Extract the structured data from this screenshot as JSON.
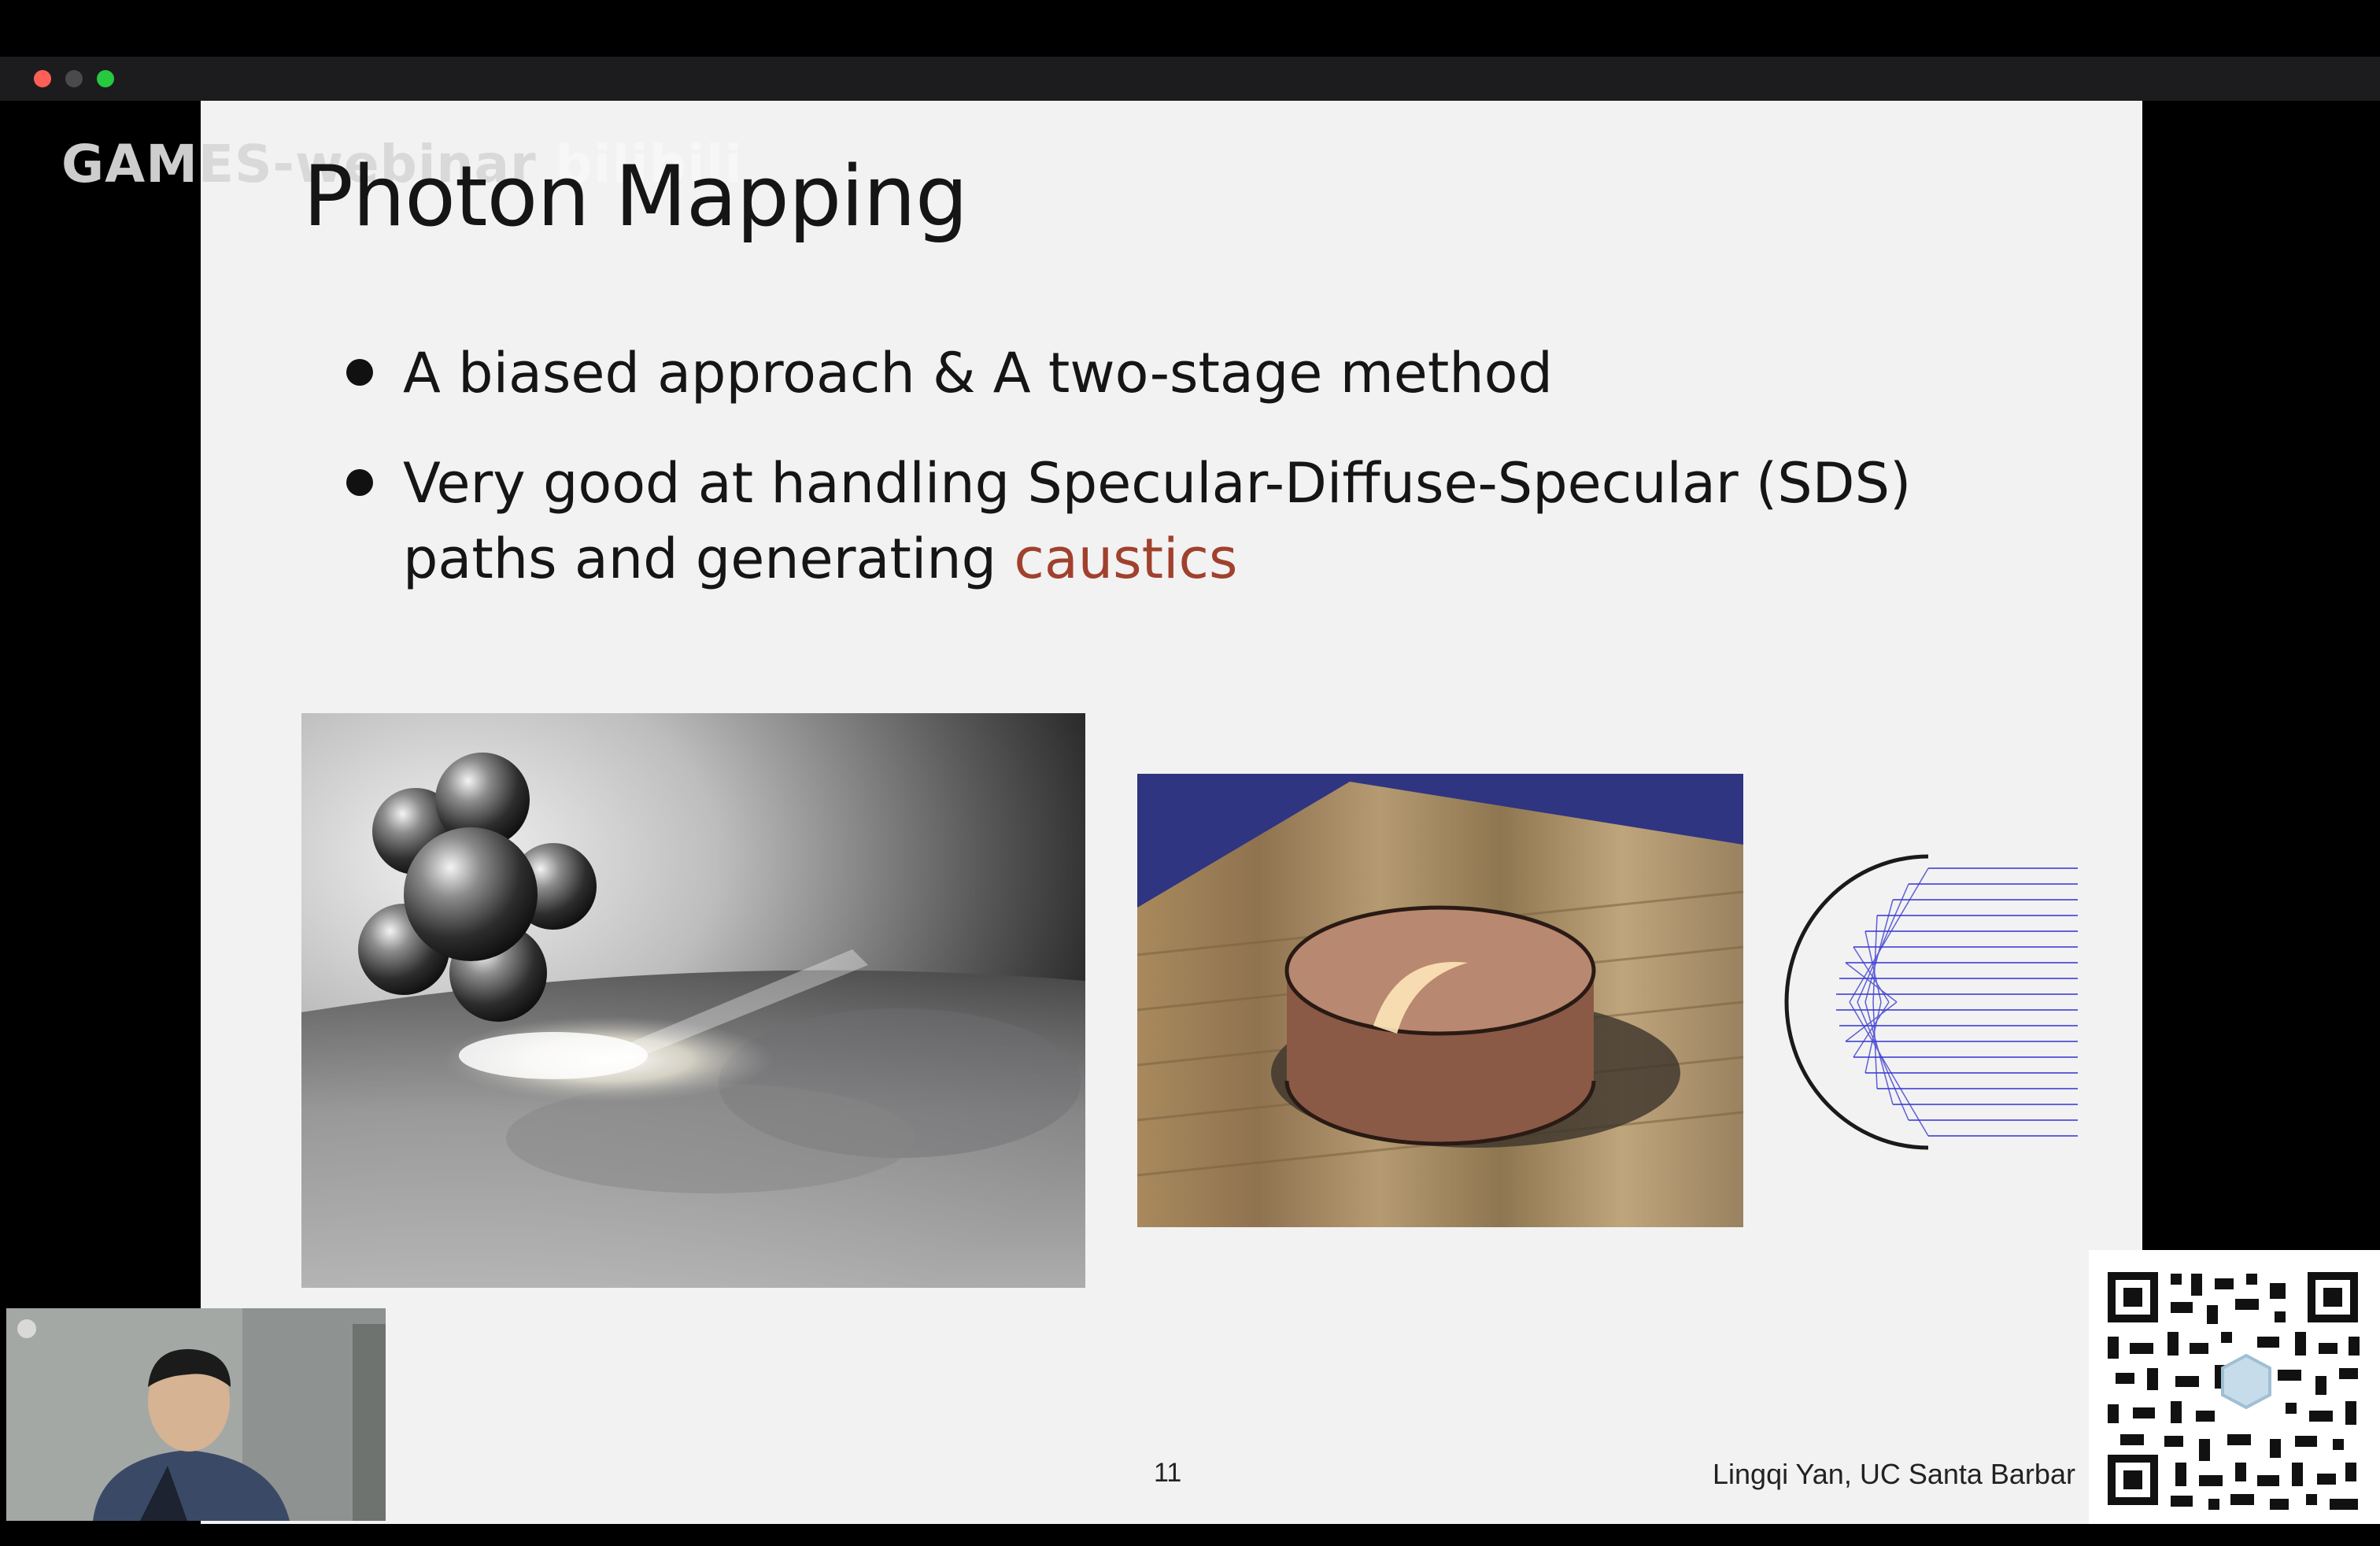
{
  "window": {
    "traffic_lights": {
      "close_color": "#ff5f57",
      "minimize_color": "#4a4a4c",
      "zoom_color": "#28c840"
    }
  },
  "overlay": {
    "watermark_text": "GAMES-webinar",
    "watermark_logo_text": "bilibili"
  },
  "slide": {
    "title": "Photon Mapping",
    "bullets": [
      {
        "line1": "A biased approach & A two-stage method"
      },
      {
        "line1": "Very good at handling Specular-Diffuse-Specular (SDS)",
        "line2_prefix": "paths and generating ",
        "line2_highlight": "caustics"
      }
    ],
    "highlight_color": "#a0412e",
    "page_number": "11",
    "author": "Lingqi Yan, UC Santa Barbar"
  },
  "images": {
    "left": "glass-object-caustics-render",
    "middle": "wooden-floor-ring-caustics-render",
    "right": "ray-reflection-diagram"
  }
}
